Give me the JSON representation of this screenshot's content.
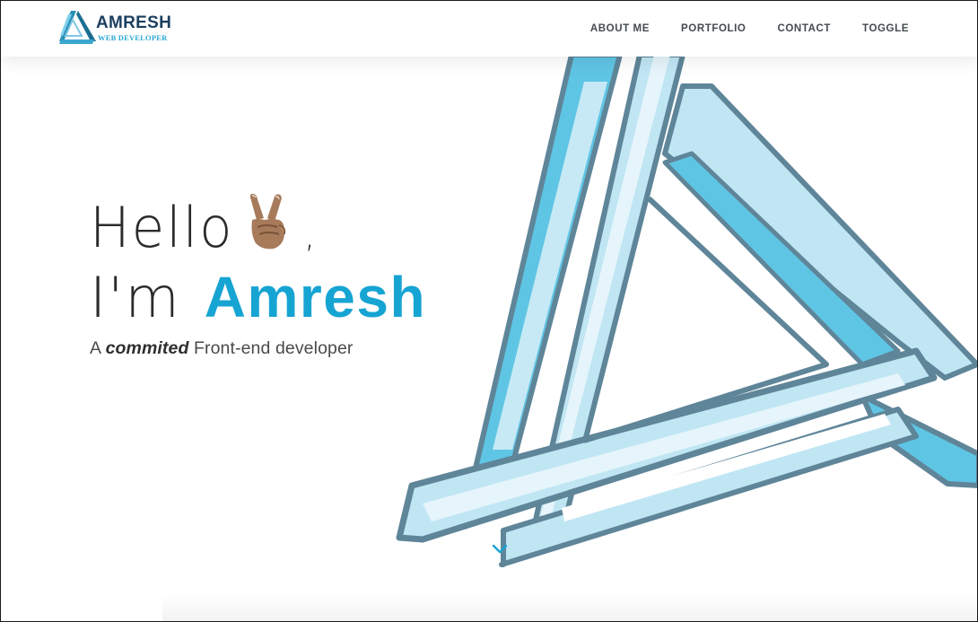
{
  "brand": {
    "name": "AMRESH",
    "tagline": "WEB DEVELOPER",
    "colors": {
      "primary": "#16a4d3",
      "dark": "#1c3f5f",
      "stroke": "#5f8599",
      "light_band": "#c0e6f4",
      "mid_band": "#6ac9e6"
    }
  },
  "nav": {
    "items": [
      {
        "label": "ABOUT ME"
      },
      {
        "label": "PORTFOLIO"
      },
      {
        "label": "CONTACT"
      },
      {
        "label": "TOGGLE"
      }
    ]
  },
  "hero": {
    "hello": "Hello",
    "emoji": "peace-hand",
    "comma": ",",
    "im": "I'm",
    "name": "Amresh",
    "tagline_prefix": "A ",
    "tagline_emphasis": "commited",
    "tagline_suffix": " Front-end developer",
    "scroll_icon": "chevron-down-icon"
  }
}
